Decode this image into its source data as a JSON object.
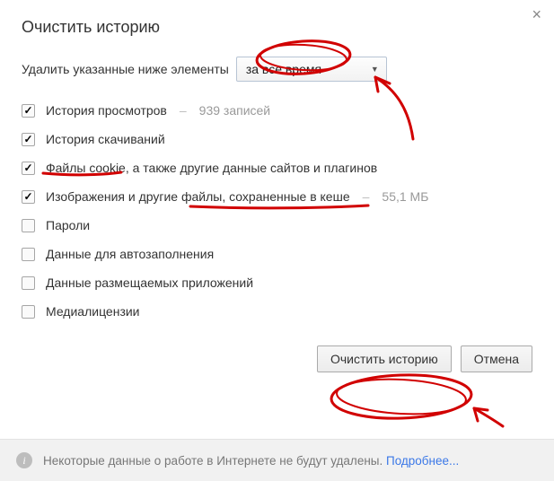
{
  "title": "Очистить историю",
  "close_glyph": "×",
  "prompt": {
    "label": "Удалить указанные ниже элементы",
    "selected": "за все время"
  },
  "options": [
    {
      "label": "История просмотров",
      "extra": "939 записей",
      "checked": true
    },
    {
      "label": "История скачиваний",
      "extra": "",
      "checked": true
    },
    {
      "label": "Файлы cookie, а также другие данные сайтов и плагинов",
      "extra": "",
      "checked": true
    },
    {
      "label": "Изображения и другие файлы, сохраненные в кеше",
      "extra": "55,1 МБ",
      "checked": true
    },
    {
      "label": "Пароли",
      "extra": "",
      "checked": false
    },
    {
      "label": "Данные для автозаполнения",
      "extra": "",
      "checked": false
    },
    {
      "label": "Данные размещаемых приложений",
      "extra": "",
      "checked": false
    },
    {
      "label": "Медиалицензии",
      "extra": "",
      "checked": false
    }
  ],
  "buttons": {
    "primary": "Очистить историю",
    "cancel": "Отмена"
  },
  "footer": {
    "text": "Некоторые данные о работе в Интернете не будут удалены.",
    "link": "Подробнее..."
  },
  "colors": {
    "annotation": "#d10000"
  }
}
